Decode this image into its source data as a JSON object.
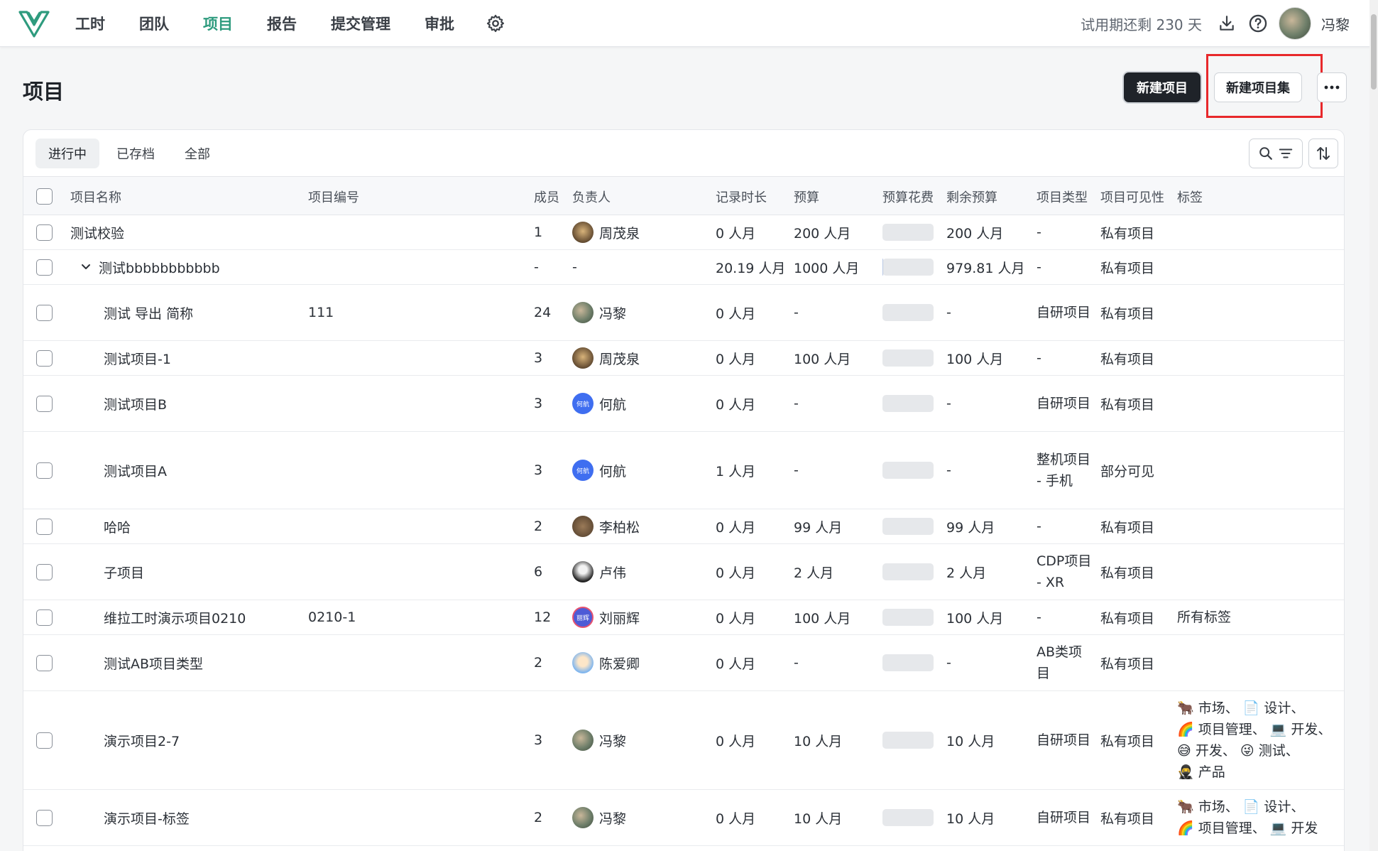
{
  "nav": {
    "items": [
      "工时",
      "团队",
      "项目",
      "报告",
      "提交管理",
      "审批"
    ],
    "active_index": 2,
    "trial_text": "试用期还剩 230 天",
    "user_name": "冯黎"
  },
  "page": {
    "title": "项目",
    "new_project_label": "新建项目",
    "new_project_set_label": "新建项目集"
  },
  "tabs": [
    "进行中",
    "已存档",
    "全部"
  ],
  "table": {
    "headers": {
      "name": "项目名称",
      "code": "项目编号",
      "members": "成员",
      "owner": "负责人",
      "logged": "记录时长",
      "budget": "预算",
      "spent": "预算花费",
      "remaining": "剩余预算",
      "type": "项目类型",
      "visibility": "项目可见性",
      "tags": "标签"
    },
    "rows": [
      {
        "name": "测试校验",
        "code": "",
        "members": "1",
        "owner": "周茂泉",
        "avatar": "dog",
        "logged": "0 人月",
        "budget": "200 人月",
        "spent_fraction": 0,
        "remaining": "200 人月",
        "type": "-",
        "visibility": "私有项目",
        "tags": ""
      },
      {
        "name": "测试bbbbbbbbbbb",
        "code": "",
        "members": "-",
        "owner": "-",
        "avatar": "",
        "logged": "20.19 人月",
        "budget": "1000 人月",
        "spent_fraction": 0.02,
        "remaining": "979.81 人月",
        "type": "-",
        "visibility": "私有项目",
        "tags": "",
        "group": true
      },
      {
        "name": "测试 导出 简称",
        "code": "111",
        "members": "24",
        "owner": "冯黎",
        "avatar": "photo",
        "logged": "0 人月",
        "budget": "-",
        "spent_fraction": 0,
        "remaining": "-",
        "type": "自研项目",
        "visibility": "私有项目",
        "tags": "",
        "child": true
      },
      {
        "name": "测试项目-1",
        "code": "",
        "members": "3",
        "owner": "周茂泉",
        "avatar": "dog",
        "logged": "0 人月",
        "budget": "100 人月",
        "spent_fraction": 0,
        "remaining": "100 人月",
        "type": "-",
        "visibility": "私有项目",
        "tags": "",
        "child": true
      },
      {
        "name": "测试项目B",
        "code": "",
        "members": "3",
        "owner": "何航",
        "avatar": "blue",
        "avatar_text": "何航",
        "logged": "0 人月",
        "budget": "-",
        "spent_fraction": 0,
        "remaining": "-",
        "type": "自研项目",
        "visibility": "私有项目",
        "tags": "",
        "child": true
      },
      {
        "name": "测试项目A",
        "code": "",
        "members": "3",
        "owner": "何航",
        "avatar": "blue",
        "avatar_text": "何航",
        "logged": "1 人月",
        "budget": "-",
        "spent_fraction": 0,
        "remaining": "-",
        "type": "整机项目 - 手机",
        "visibility": "部分可见",
        "tags": "",
        "child": true
      },
      {
        "name": "哈哈",
        "code": "",
        "members": "2",
        "owner": "李柏松",
        "avatar": "cat",
        "logged": "0 人月",
        "budget": "99 人月",
        "spent_fraction": 0,
        "remaining": "99 人月",
        "type": "-",
        "visibility": "私有项目",
        "tags": "",
        "child": true
      },
      {
        "name": "子项目",
        "code": "",
        "members": "6",
        "owner": "卢伟",
        "avatar": "bw",
        "logged": "0 人月",
        "budget": "2 人月",
        "spent_fraction": 0,
        "remaining": "2 人月",
        "type": "CDP项目 - XR",
        "visibility": "私有项目",
        "tags": "",
        "child": true
      },
      {
        "name": "维拉工时演示项目0210",
        "code": "0210-1",
        "members": "12",
        "owner": "刘丽辉",
        "avatar": "liu",
        "avatar_text": "丽辉",
        "logged": "0 人月",
        "budget": "100 人月",
        "spent_fraction": 0,
        "remaining": "100 人月",
        "type": "-",
        "visibility": "私有项目",
        "tags": "所有标签",
        "child": true
      },
      {
        "name": "测试AB项目类型",
        "code": "",
        "members": "2",
        "owner": "陈爱卿",
        "avatar": "anime",
        "logged": "0 人月",
        "budget": "-",
        "spent_fraction": 0,
        "remaining": "-",
        "type": "AB类项目",
        "visibility": "私有项目",
        "tags": "",
        "child": true
      },
      {
        "name": "演示项目2-7",
        "code": "",
        "members": "3",
        "owner": "冯黎",
        "avatar": "photo",
        "logged": "0 人月",
        "budget": "10 人月",
        "spent_fraction": 0,
        "remaining": "10 人月",
        "type": "自研项目",
        "visibility": "私有项目",
        "tags_lines": [
          "🐂 市场、 📄 设计、",
          "🌈 项目管理、 💻 开发、",
          "😅 开发、 😜 测试、",
          "🥷 产品"
        ],
        "child": true
      },
      {
        "name": "演示项目-标签",
        "code": "",
        "members": "2",
        "owner": "冯黎",
        "avatar": "photo",
        "logged": "0 人月",
        "budget": "10 人月",
        "spent_fraction": 0,
        "remaining": "10 人月",
        "type": "自研项目",
        "visibility": "私有项目",
        "tags_lines": [
          "🐂 市场、 📄 设计、",
          "🌈 项目管理、 💻 开发"
        ],
        "child": true
      }
    ]
  }
}
